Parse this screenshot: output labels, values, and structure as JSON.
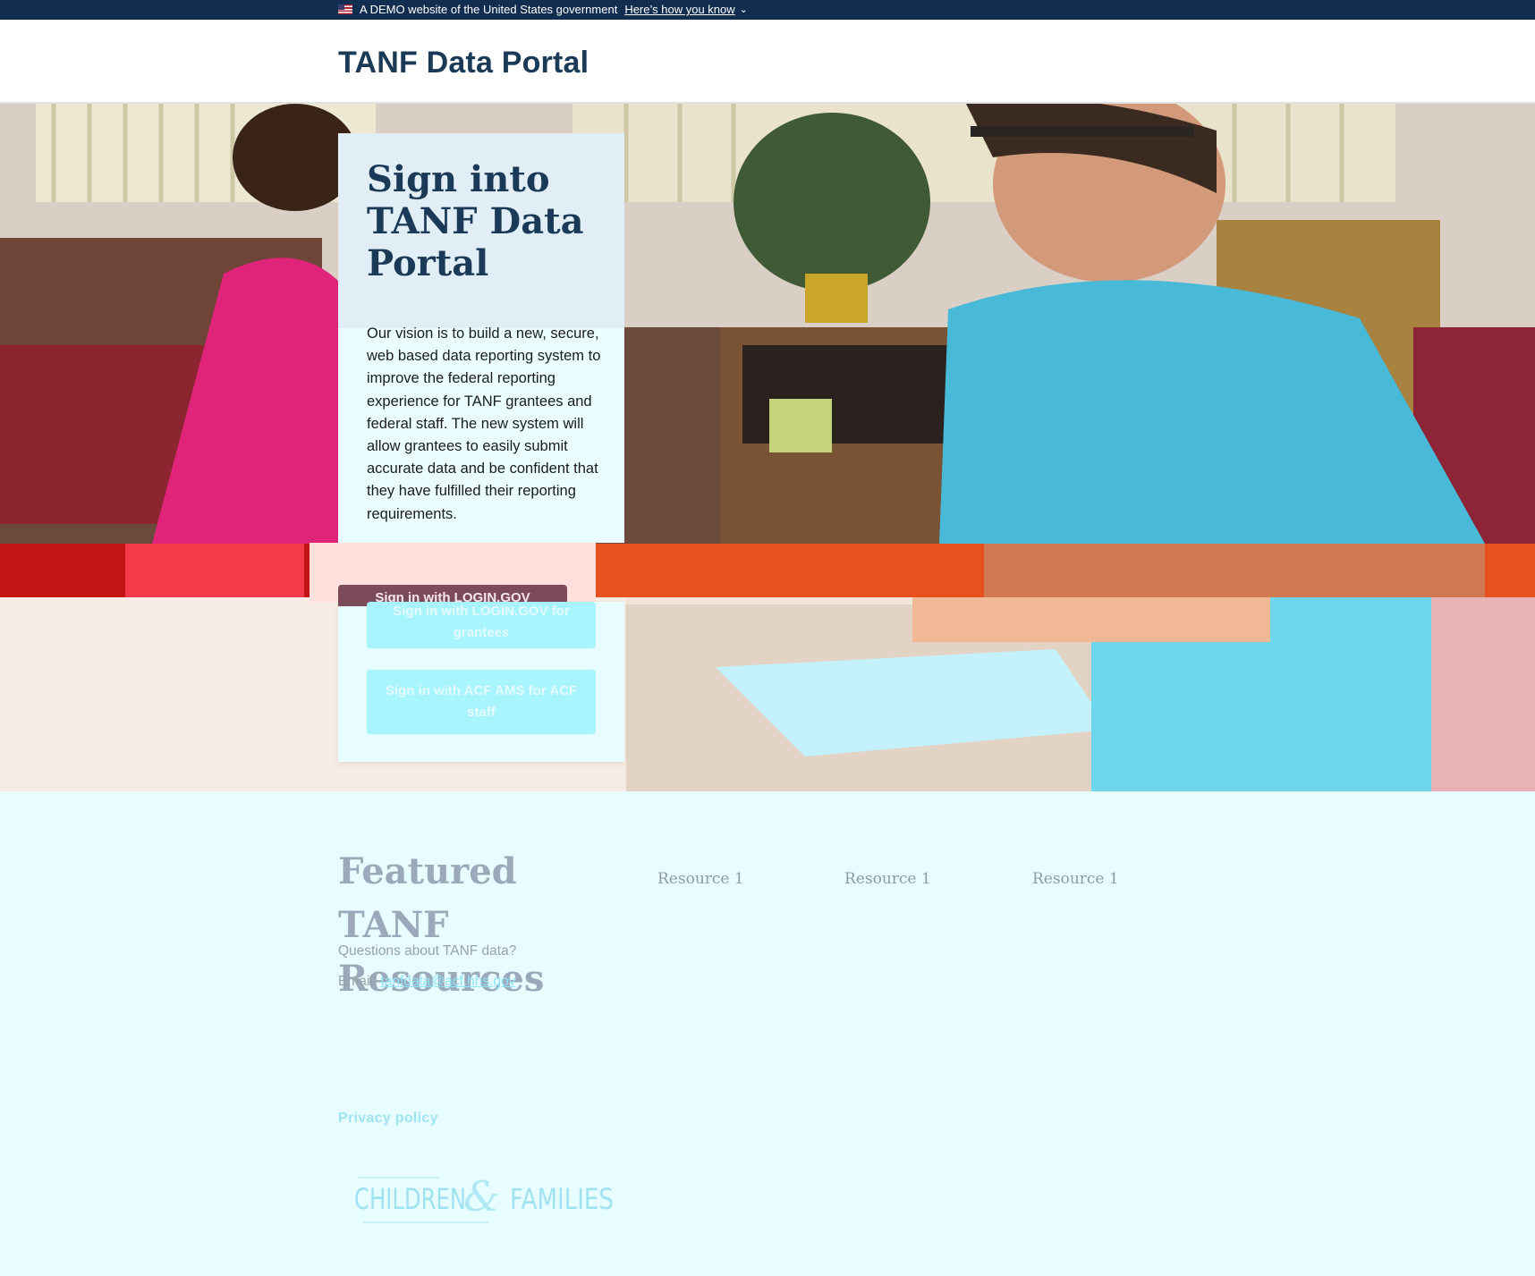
{
  "gov_banner": {
    "text": "A DEMO website of the United States government",
    "link": "Here’s how you know"
  },
  "header": {
    "title": "TANF Data Portal"
  },
  "signin_card": {
    "heading": "Sign into TANF Data Portal",
    "description": "Our vision is to build a new, secure, web based data reporting system to improve the federal reporting experience for TANF grantees and federal staff. The new system will allow grantees to easily submit accurate data and be confident that they have fulfilled their reporting requirements.",
    "login_button": "Sign in with LOGIN.GOV",
    "grantee_button": "Sign in with LOGIN.GOV for grantees",
    "acf_button": "Sign in with ACF AMS for ACF staff"
  },
  "featured": {
    "title": "Featured TANF Resources",
    "resources": [
      "Resource 1",
      "Resource 1",
      "Resource 1"
    ],
    "questions": "Questions about TANF data?",
    "email_label": "Email:",
    "email": "tanfdata@acf.hhs.gov"
  },
  "footer": {
    "privacy": "Privacy policy",
    "logo_text_left": "CHILDREN",
    "logo_ampersand": "&",
    "logo_text_right": "FAMILIES"
  },
  "colors": {
    "banner_bg": "#112e51",
    "title": "#1b3a57",
    "page_bg": "#e8fdff",
    "button_bg": "#a8f4ff"
  }
}
